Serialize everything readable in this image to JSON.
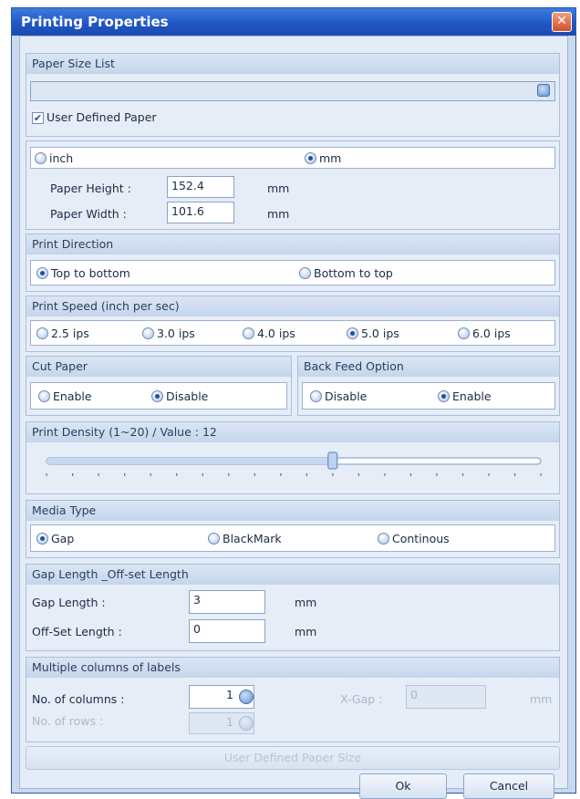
{
  "window": {
    "title": "Printing Properties",
    "close_glyph": "✕"
  },
  "paper_size": {
    "header": "Paper Size List",
    "select_value": "",
    "user_defined_label": "User Defined Paper",
    "user_defined_checked": true,
    "check_glyph": "✔"
  },
  "units": {
    "inch_label": "inch",
    "mm_label": "mm",
    "selected": "mm",
    "paper_height_label": "Paper Height :",
    "paper_height_value": "152.4",
    "paper_height_unit": "mm",
    "paper_width_label": "Paper Width :",
    "paper_width_value": "101.6",
    "paper_width_unit": "mm"
  },
  "print_direction": {
    "header": "Print Direction",
    "options": [
      "Top to bottom",
      "Bottom to top"
    ],
    "selected": "Top to bottom"
  },
  "print_speed": {
    "header": "Print Speed (inch per sec)",
    "options": [
      "2.5 ips",
      "3.0 ips",
      "4.0 ips",
      "5.0 ips",
      "6.0 ips"
    ],
    "selected": "5.0 ips"
  },
  "cut_paper": {
    "header": "Cut Paper",
    "options": [
      "Enable",
      "Disable"
    ],
    "selected": "Disable"
  },
  "back_feed": {
    "header": "Back Feed Option",
    "options": [
      "Disable",
      "Enable"
    ],
    "selected": "Enable"
  },
  "print_density": {
    "header": "Print Density (1~20) / Value : 12",
    "min": 1,
    "max": 20,
    "value": 12
  },
  "media_type": {
    "header": "Media Type",
    "options": [
      "Gap",
      "BlackMark",
      "Continous"
    ],
    "selected": "Gap"
  },
  "gap": {
    "header": "Gap Length _Off-set Length",
    "gap_label": "Gap Length :",
    "gap_value": "3",
    "gap_unit": "mm",
    "offset_label": "Off-Set Length :",
    "offset_value": "0",
    "offset_unit": "mm"
  },
  "columns": {
    "header": "Multiple columns of labels",
    "columns_label": "No. of columns :",
    "columns_value": "1",
    "rows_label": "No. of rows :",
    "rows_value": "1",
    "xgap_label": "X-Gap :",
    "xgap_value": "0",
    "xgap_unit": "mm"
  },
  "buttons": {
    "user_defined_size": "User Defined Paper Size",
    "ok": "Ok",
    "cancel": "Cancel"
  },
  "colors": {
    "titlebar": "#1f55c2",
    "panel": "#e4ecf7",
    "accent": "#1f4fa0"
  }
}
